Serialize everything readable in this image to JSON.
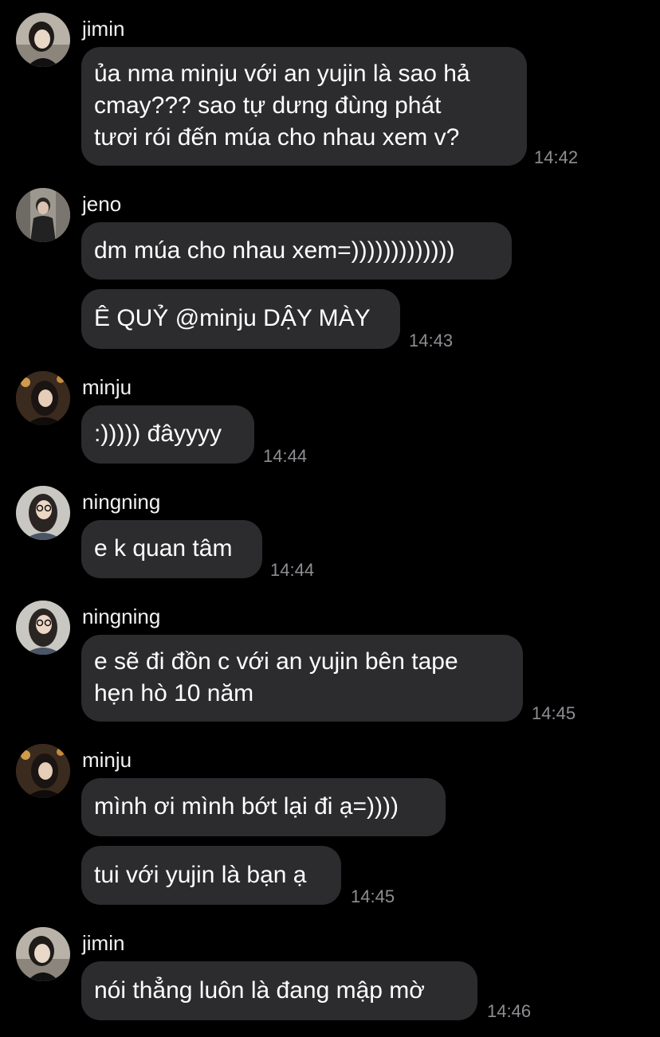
{
  "colors": {
    "background": "#000000",
    "bubble": "#2c2c2e",
    "timestamp": "#8e8e93",
    "text": "#ffffff"
  },
  "messages": [
    {
      "sender": "jimin",
      "avatar_icon": "jimin-avatar",
      "bubbles": [
        {
          "lines": [
            "ủa nma minju với an yujin là sao hả",
            "cmay??? sao tự dưng đùng phát",
            "tươi rói đến múa cho nhau xem v?"
          ]
        }
      ],
      "time": "14:42"
    },
    {
      "sender": "jeno",
      "avatar_icon": "jeno-avatar",
      "bubbles": [
        {
          "lines": [
            "dm múa cho nhau xem=)))))))))))))"
          ]
        },
        {
          "lines": [
            "Ê QUỶ @minju DẬY MÀY"
          ]
        }
      ],
      "time": "14:43"
    },
    {
      "sender": "minju",
      "avatar_icon": "minju-avatar",
      "bubbles": [
        {
          "lines": [
            ":))))) đâyyyy"
          ]
        }
      ],
      "time": "14:44"
    },
    {
      "sender": "ningning",
      "avatar_icon": "ningning-avatar",
      "bubbles": [
        {
          "lines": [
            "e k quan tâm"
          ]
        }
      ],
      "time": "14:44"
    },
    {
      "sender": "ningning",
      "avatar_icon": "ningning-avatar",
      "bubbles": [
        {
          "lines": [
            "e sẽ đi đồn c với an yujin bên tape",
            "hẹn hò 10 năm"
          ]
        }
      ],
      "time": "14:45"
    },
    {
      "sender": "minju",
      "avatar_icon": "minju-avatar",
      "bubbles": [
        {
          "lines": [
            "mình ơi mình bớt lại đi ạ=))))"
          ]
        },
        {
          "lines": [
            "tui với yujin là bạn ạ"
          ]
        }
      ],
      "time": "14:45"
    },
    {
      "sender": "jimin",
      "avatar_icon": "jimin-avatar",
      "bubbles": [
        {
          "lines": [
            "nói thẳng luôn là đang mập mờ"
          ]
        }
      ],
      "time": "14:46"
    }
  ]
}
